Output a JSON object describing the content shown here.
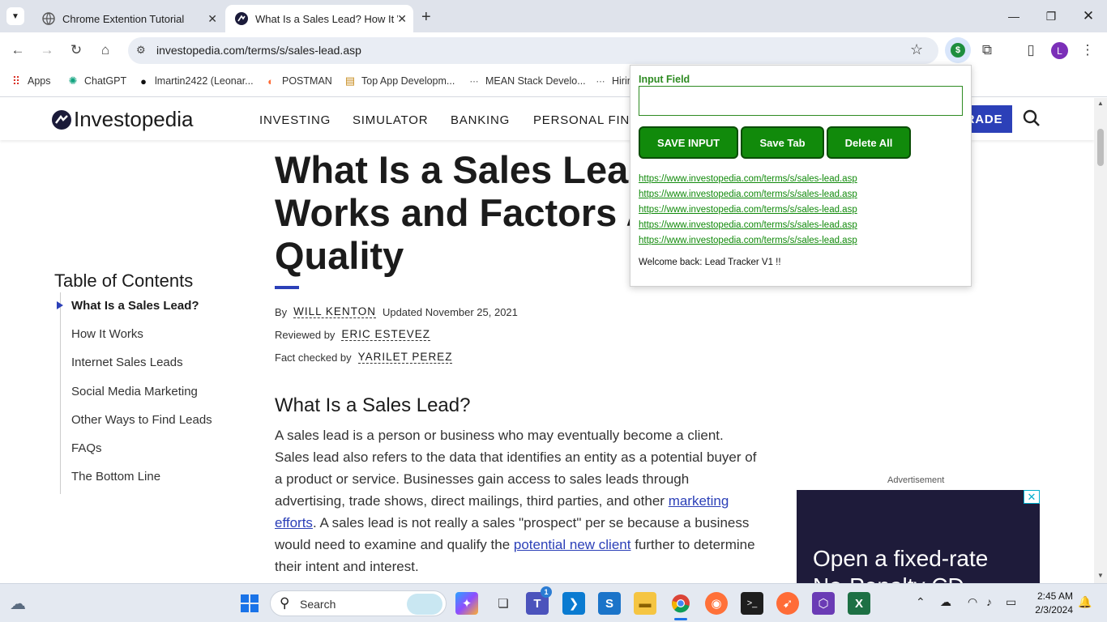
{
  "browser": {
    "tabs": [
      {
        "title": "Chrome Extention Tutorial",
        "active": false
      },
      {
        "title": "What Is a Sales Lead? How It W",
        "active": true
      }
    ],
    "url": "investopedia.com/terms/s/sales-lead.asp",
    "profile_initial": "L",
    "bookmarks": [
      "Apps",
      "ChatGPT",
      "lmartin2422 (Leonar...",
      "POSTMAN",
      "Top App Developm...",
      "MEAN Stack Develo...",
      "Hirin"
    ]
  },
  "site": {
    "logo": "Investopedia",
    "nav": [
      "INVESTING",
      "SIMULATOR",
      "BANKING",
      "PERSONAL FINA"
    ],
    "trade_label": "RADE"
  },
  "article": {
    "title_lines": [
      "What Is a Sales Lead?",
      "Works and Factors Aff",
      "Quality"
    ],
    "by_label": "By",
    "author": "WILL KENTON",
    "updated": "Updated November 25, 2021",
    "reviewed_label": "Reviewed by",
    "reviewer": "ERIC ESTEVEZ",
    "factcheck_label": "Fact checked by",
    "factchecker": "YARILET PEREZ",
    "section_title": "What Is a Sales Lead?",
    "para_1": "A sales lead is a person or business who may eventually become a client. Sales lead also refers to the data that identifies an entity as a potential buyer of a product or service. Businesses gain access to sales leads through advertising, trade shows, direct mailings, third parties, and other ",
    "link_1": "marketing efforts",
    "para_2": ". A sales lead is not really a sales \"prospect\" per se because a business would need to examine and qualify the ",
    "link_2": "potential new client",
    "para_3": " further to determine their intent and interest."
  },
  "toc": {
    "title": "Table of Contents",
    "items": [
      "What Is a Sales Lead?",
      "How It Works",
      "Internet Sales Leads",
      "Social Media Marketing",
      "Other Ways to Find Leads",
      "FAQs",
      "The Bottom Line"
    ]
  },
  "ad": {
    "label": "Advertisement",
    "text_1": "Open a fixed-rate",
    "text_2": "No-Penalty CD"
  },
  "popup": {
    "input_label": "Input Field",
    "input_value": "",
    "buttons": [
      "SAVE INPUT",
      "Save Tab",
      "Delete All"
    ],
    "links": [
      "https://www.investopedia.com/terms/s/sales-lead.asp",
      "https://www.investopedia.com/terms/s/sales-lead.asp",
      "https://www.investopedia.com/terms/s/sales-lead.asp",
      "https://www.investopedia.com/terms/s/sales-lead.asp",
      "https://www.investopedia.com/terms/s/sales-lead.asp"
    ],
    "message": "Welcome back: Lead Tracker V1 !!",
    "accent_color": "#118a0b"
  },
  "taskbar": {
    "search_placeholder": "Search",
    "time": "2:45 AM",
    "date": "2/3/2024",
    "teams_badge": "1"
  }
}
